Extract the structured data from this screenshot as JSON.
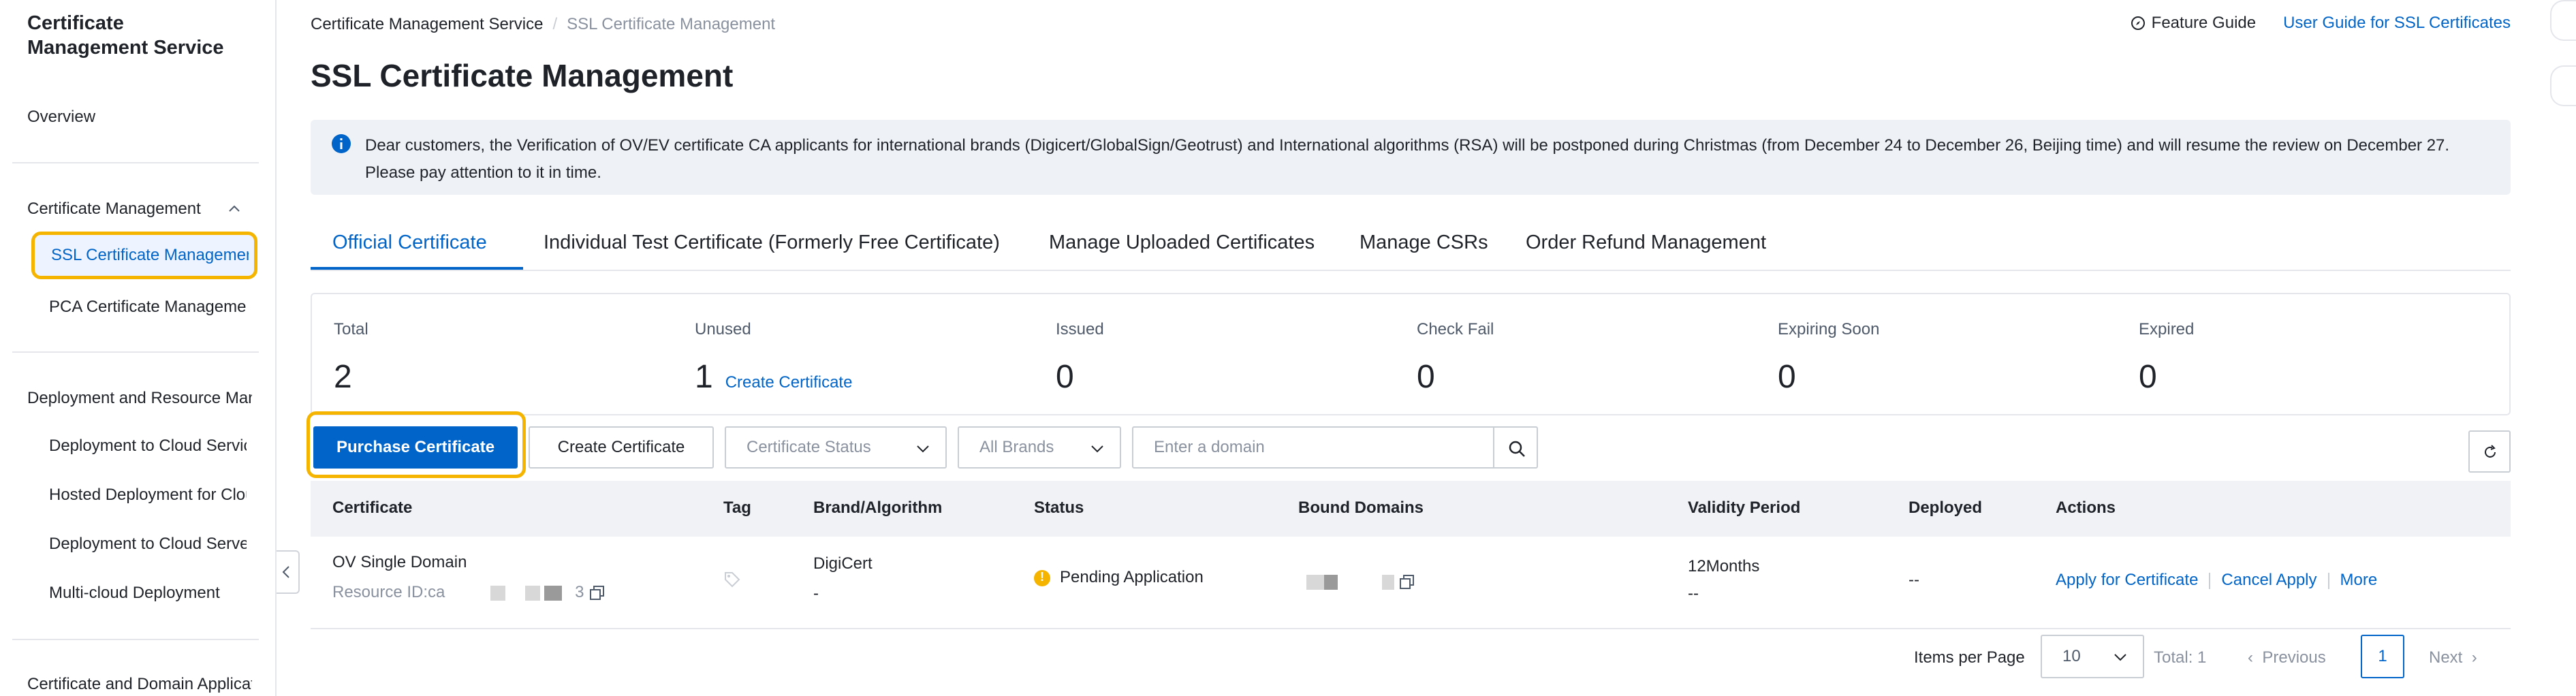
{
  "sidebar": {
    "title": "Certificate Management Service",
    "overview": "Overview",
    "group_cert_mgmt": "Certificate Management",
    "item_ssl": "SSL Certificate Management",
    "item_pca": "PCA Certificate Management",
    "group_deploy": "Deployment and Resource Management",
    "item_deploy_cloud_1": "Deployment to Cloud Services",
    "item_hosted": "Hosted Deployment for Cloud Services",
    "item_deploy_cloud_2": "Deployment to Cloud Servers",
    "item_multicloud": "Multi-cloud Deployment",
    "group_cert_domain": "Certificate and Domain Application"
  },
  "breadcrumb": {
    "level1": "Certificate Management Service",
    "separator": "/",
    "level2": "SSL Certificate Management"
  },
  "header": {
    "feature_guide": "Feature Guide",
    "user_guide": "User Guide for SSL Certificates",
    "page_title": "SSL Certificate Management"
  },
  "notice": {
    "text": "Dear customers, the Verification of OV/EV certificate CA applicants for international brands (Digicert/GlobalSign/Geotrust) and International algorithms (RSA) will be postponed during Christmas (from December 24 to December 26, Beijing time) and will resume the review on December 27. Please pay attention to it in time."
  },
  "tabs": [
    {
      "label": "Official Certificate",
      "active": true
    },
    {
      "label": "Individual Test Certificate (Formerly Free Certificate)",
      "active": false
    },
    {
      "label": "Manage Uploaded Certificates",
      "active": false
    },
    {
      "label": "Manage CSRs",
      "active": false
    },
    {
      "label": "Order Refund Management",
      "active": false
    }
  ],
  "stats": [
    {
      "label": "Total",
      "value": "2"
    },
    {
      "label": "Unused",
      "value": "1",
      "link": "Create Certificate"
    },
    {
      "label": "Issued",
      "value": "0"
    },
    {
      "label": "Check Fail",
      "value": "0"
    },
    {
      "label": "Expiring Soon",
      "value": "0"
    },
    {
      "label": "Expired",
      "value": "0"
    }
  ],
  "toolbar": {
    "purchase_label": "Purchase Certificate",
    "create_label": "Create Certificate",
    "status_select": "Certificate Status",
    "brand_select": "All Brands",
    "search_placeholder": "Enter a domain"
  },
  "table": {
    "columns": [
      "Certificate",
      "Tag",
      "Brand/Algorithm",
      "Status",
      "Bound Domains",
      "Validity Period",
      "Deployed",
      "Actions"
    ],
    "rows": [
      {
        "certificate_name": "OV Single Domain",
        "resource_prefix": "Resource ID:ca",
        "resource_suffix": "3",
        "brand": "DigiCert",
        "algorithm": "-",
        "status": "Pending Application",
        "validity": "12Months",
        "validity_sub": "--",
        "deployed": "--",
        "actions": [
          "Apply for Certificate",
          "Cancel Apply",
          "More"
        ]
      }
    ]
  },
  "pagination": {
    "items_per_page_label": "Items per Page",
    "page_size": "10",
    "total": "Total: 1",
    "previous": "Previous",
    "current_page": "1",
    "next": "Next"
  },
  "colors": {
    "primary": "#0064c8",
    "highlight_outline": "#f4b400",
    "warning": "#f4b400"
  }
}
